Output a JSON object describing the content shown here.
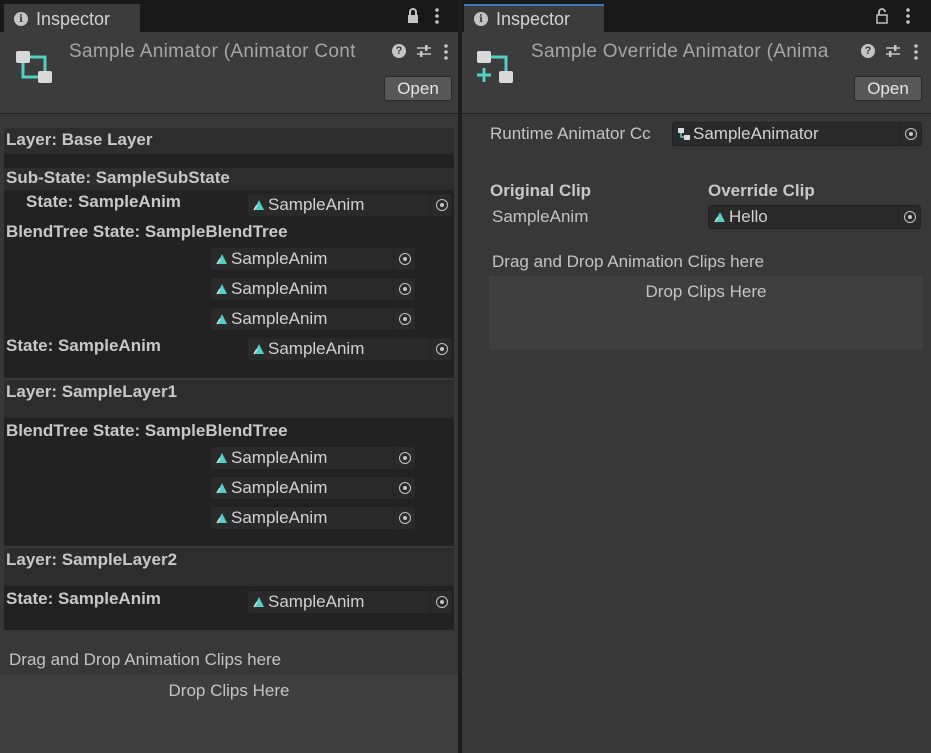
{
  "left": {
    "tab_label": "Inspector",
    "title": "Sample Animator (Animator Cont",
    "open_label": "Open",
    "layers": [
      {
        "title": "Layer: Base Layer",
        "substate_title": "Sub-State: SampleSubState",
        "substate_state_label": "State: SampleAnim",
        "substate_clip": "SampleAnim",
        "blendtree_title": "BlendTree State: SampleBlendTree",
        "blend_clips": [
          "SampleAnim",
          "SampleAnim",
          "SampleAnim"
        ],
        "state_label": "State: SampleAnim",
        "state_clip": "SampleAnim"
      },
      {
        "title": "Layer: SampleLayer1",
        "blendtree_title": "BlendTree State: SampleBlendTree",
        "blend_clips": [
          "SampleAnim",
          "SampleAnim",
          "SampleAnim"
        ]
      },
      {
        "title": "Layer: SampleLayer2",
        "state_label": "State: SampleAnim",
        "state_clip": "SampleAnim"
      }
    ],
    "drag_hint": "Drag and Drop Animation Clips here",
    "drop_label": "Drop Clips Here"
  },
  "right": {
    "tab_label": "Inspector",
    "title": "Sample Override Animator (Anima",
    "open_label": "Open",
    "runtime_label": "Runtime Animator Cc",
    "runtime_value": "SampleAnimator",
    "original_header": "Original Clip",
    "override_header": "Override Clip",
    "original_clip": "SampleAnim",
    "override_clip": "Hello",
    "drag_hint": "Drag and Drop Animation Clips here",
    "drop_label": "Drop Clips Here"
  },
  "icons": {
    "info": "info-icon",
    "lock": "lock-icon",
    "more": "more-vert-icon",
    "help": "help-icon",
    "preset": "preset-sliders-icon",
    "animator_controller": "animator-controller-icon",
    "override_controller": "animator-override-controller-icon",
    "clip": "animation-clip-icon",
    "picker": "object-picker-icon"
  },
  "colors": {
    "accent_tab": "#3a79bb",
    "icon_teal": "#4fd1c5"
  }
}
